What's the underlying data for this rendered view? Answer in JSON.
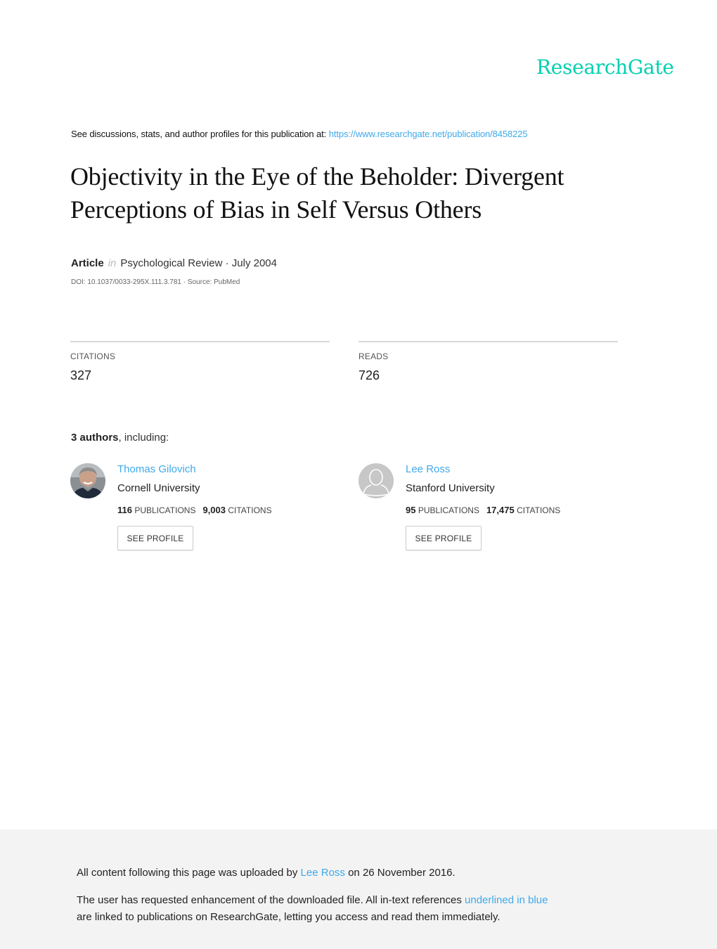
{
  "brand": {
    "logo_text": "ResearchGate",
    "accent_color": "#00d0af",
    "link_color": "#40a9ea"
  },
  "intro": {
    "text": "See discussions, stats, and author profiles for this publication at:",
    "url": "https://www.researchgate.net/publication/8458225"
  },
  "publication": {
    "title": "Objectivity in the Eye of the Beholder: Divergent Perceptions of Bias in Self Versus Others",
    "type": "Article",
    "in_label": "in",
    "journal_date": "Psychological Review · July 2004",
    "doi_line": "DOI: 10.1037/0033-295X.111.3.781 · Source: PubMed"
  },
  "stats": {
    "citations_label": "CITATIONS",
    "citations_value": "327",
    "reads_label": "READS",
    "reads_value": "726"
  },
  "authors_header": {
    "count": "3 authors",
    "suffix": ", including:"
  },
  "authors": [
    {
      "name": "Thomas Gilovich",
      "institution": "Cornell University",
      "publications": "116",
      "publications_label": "PUBLICATIONS",
      "citations": "9,003",
      "citations_label": "CITATIONS",
      "button": "SEE PROFILE",
      "avatar": "photo"
    },
    {
      "name": "Lee Ross",
      "institution": "Stanford University",
      "publications": "95",
      "publications_label": "PUBLICATIONS",
      "citations": "17,475",
      "citations_label": "CITATIONS",
      "button": "SEE PROFILE",
      "avatar": "default-user-silhouette"
    }
  ],
  "footer": {
    "line1_pre": "All content following this page was uploaded by",
    "line1_link": "Lee Ross",
    "line1_post": "on 26 November 2016.",
    "line2_pre": "The user has requested enhancement of the downloaded file. All in-text references",
    "line2_link": "underlined in blue",
    "line3": "are linked to publications on ResearchGate, letting you access and read them immediately."
  }
}
